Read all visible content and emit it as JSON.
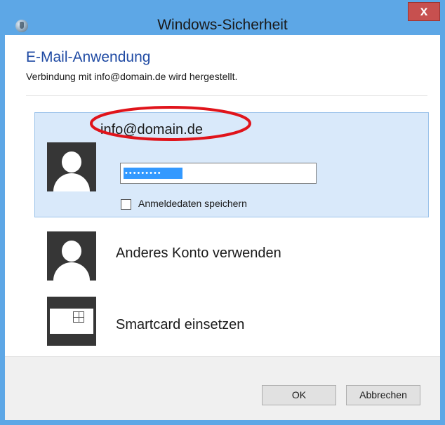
{
  "window": {
    "title": "Windows-Sicherheit",
    "close_label": "x"
  },
  "header": {
    "heading": "E-Mail-Anwendung",
    "subheading": "Verbindung mit info@domain.de wird hergestellt."
  },
  "selected_account": {
    "name": "info@domain.de",
    "password_masked": "•••••••••",
    "remember_label": "Anmeldedaten speichern",
    "remember_checked": false
  },
  "options": [
    {
      "label": "Anderes Konto verwenden",
      "icon": "user-icon"
    },
    {
      "label": "Smartcard einsetzen",
      "icon": "smartcard-icon"
    }
  ],
  "buttons": {
    "ok": "OK",
    "cancel": "Abbrechen"
  },
  "colors": {
    "titlebar": "#5da7e6",
    "close_button": "#c7504f",
    "heading_blue": "#1f4aa3",
    "selected_tile": "#d9e9fa",
    "annotation_red": "#e0141b"
  }
}
